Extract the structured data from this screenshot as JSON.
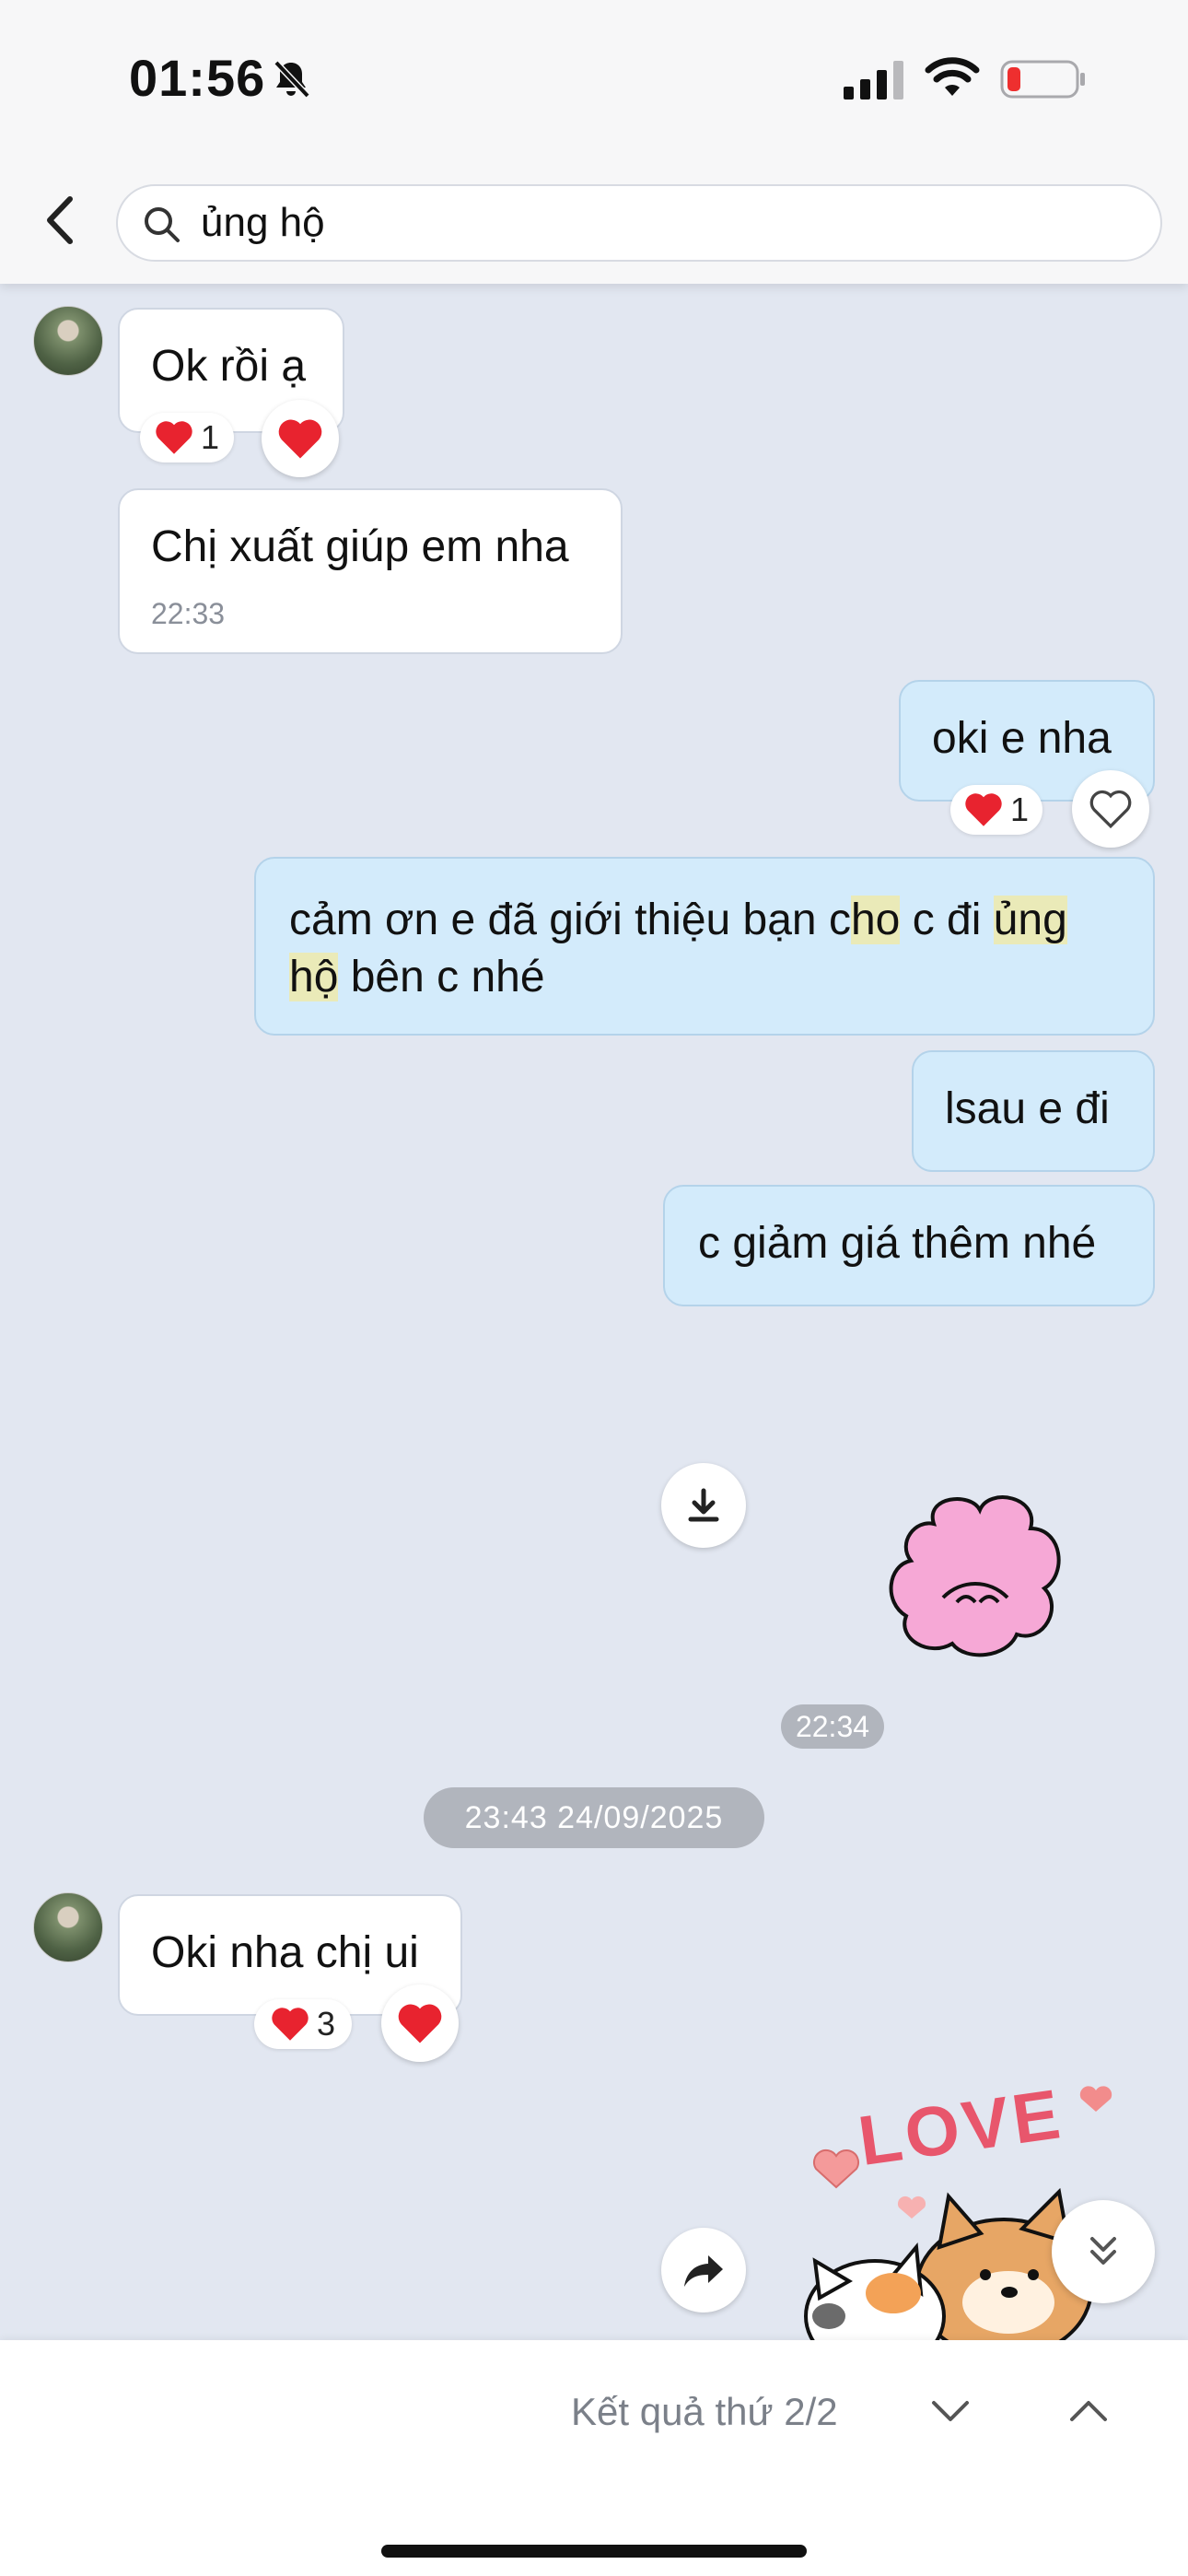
{
  "status_bar": {
    "time": "01:56"
  },
  "search": {
    "query": "ủng hộ"
  },
  "messages": {
    "m1": {
      "text": "Ok rồi ạ",
      "reaction_count": "1"
    },
    "m2": {
      "text": "Chị xuất giúp em nha",
      "time": "22:33"
    },
    "m3": {
      "text": "oki e nha",
      "reaction_count": "1"
    },
    "m4": {
      "part1": "cảm ơn e đã giới thiệu bạn c",
      "hl1": "ho",
      "part2": " c đi ",
      "hl2": "ủng",
      "hl3": "hộ",
      "part3": " bên c nhé"
    },
    "m5": {
      "text": "lsau e đi"
    },
    "m6": {
      "text": "c giảm giá thêm nhé"
    },
    "sticker_time": "22:34",
    "m7": {
      "text": "Oki nha chị ui",
      "reaction_count": "3"
    },
    "sticker2_text": "LOVE"
  },
  "date_separator": "23:43 24/09/2025",
  "footer": {
    "result_label": "Kết quả thứ 2/2"
  },
  "colors": {
    "background": "#e2e7f1",
    "outgoing_bubble": "#d3ebfb",
    "incoming_bubble": "#ffffff",
    "highlight": "#eaeab8",
    "heart": "#e8232f"
  }
}
